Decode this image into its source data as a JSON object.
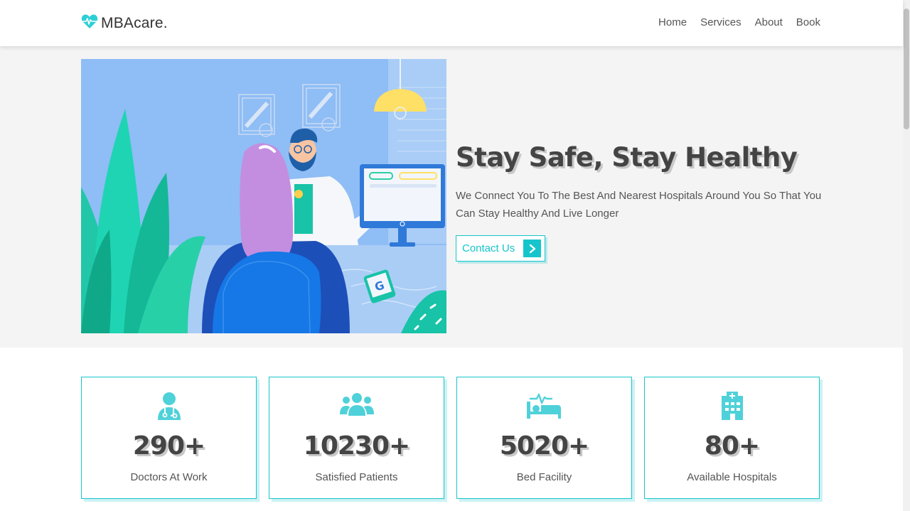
{
  "brand": {
    "name": "MBAcare."
  },
  "nav": {
    "items": [
      "Home",
      "Services",
      "About",
      "Book"
    ]
  },
  "hero": {
    "title": "Stay Safe, Stay Healthy",
    "text": "We Connect You To The Best And Nearest Hospitals Around You So That You Can Stay Healthy And Live Longer",
    "button_label": "Contact Us"
  },
  "stats": [
    {
      "icon": "doctor-icon",
      "value": "290+",
      "label": "Doctors At Work"
    },
    {
      "icon": "users-icon",
      "value": "10230+",
      "label": "Satisfied Patients"
    },
    {
      "icon": "bed-icon",
      "value": "5020+",
      "label": "Bed Facility"
    },
    {
      "icon": "hospital-icon",
      "value": "80+",
      "label": "Available Hospitals"
    }
  ],
  "colors": {
    "accent": "#16c5cb",
    "icon": "#4fd1d9",
    "hero_bg": "#f4f4f4"
  }
}
